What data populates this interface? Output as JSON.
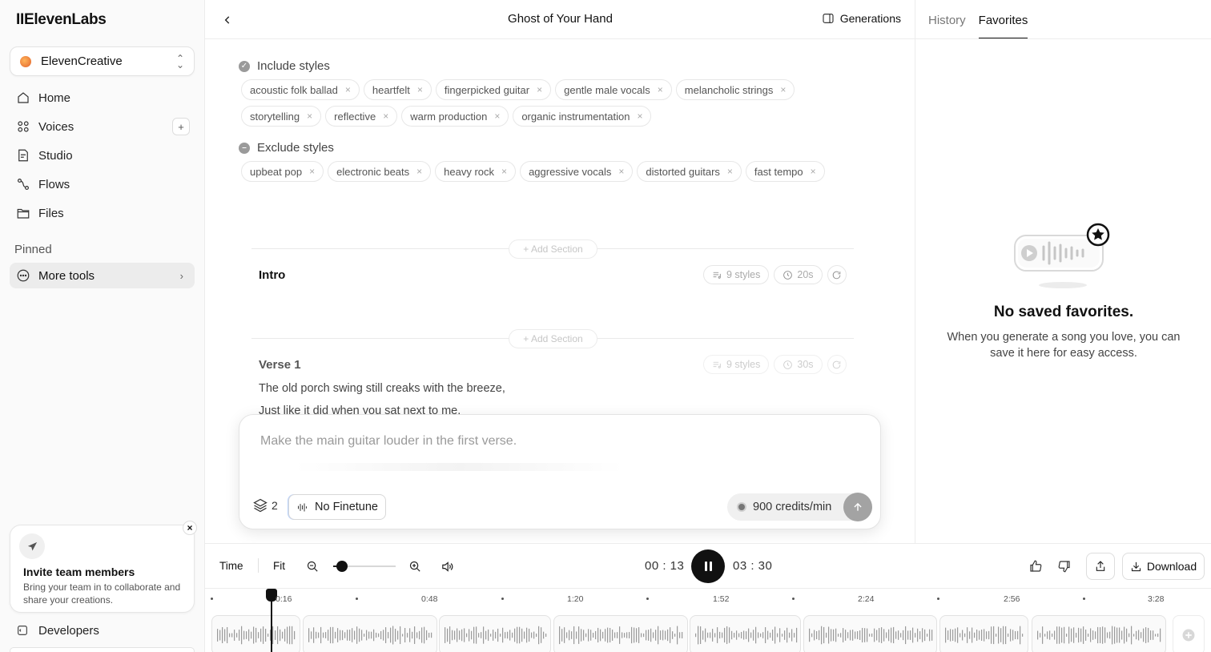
{
  "app": {
    "logo": "IIElevenLabs"
  },
  "sidebar": {
    "workspace": "ElevenCreative",
    "items": [
      {
        "label": "Home",
        "icon": "home-icon"
      },
      {
        "label": "Voices",
        "icon": "voices-icon",
        "plus": "+"
      },
      {
        "label": "Studio",
        "icon": "studio-icon"
      },
      {
        "label": "Flows",
        "icon": "flows-icon"
      },
      {
        "label": "Files",
        "icon": "files-icon"
      }
    ],
    "pinned_label": "Pinned",
    "more_tools": "More tools",
    "invite": {
      "title": "Invite team members",
      "desc": "Bring your team in to collaborate and share your creations."
    },
    "developers": "Developers"
  },
  "header": {
    "title": "Ghost of Your Hand",
    "generations": "Generations"
  },
  "right_panel": {
    "tabs": [
      "History",
      "Favorites"
    ],
    "active_tab": "Favorites",
    "empty_title": "No saved favorites.",
    "empty_desc": "When you generate a song you love, you can save it here for easy access."
  },
  "styles": {
    "include_label": "Include styles",
    "include_row1": [
      "acoustic folk ballad",
      "heartfelt",
      "fingerpicked guitar",
      "gentle male vocals",
      "melancholic strings"
    ],
    "include_row2": [
      "storytelling",
      "reflective",
      "warm production",
      "organic instrumentation"
    ],
    "exclude_label": "Exclude styles",
    "exclude": [
      "upbeat pop",
      "electronic beats",
      "heavy rock",
      "aggressive vocals",
      "distorted guitars",
      "fast tempo"
    ],
    "remove_glyph": "×"
  },
  "sections": {
    "add_label": "+ Add Section",
    "intro": {
      "title": "Intro",
      "styles": "9 styles",
      "duration": "20s"
    },
    "verse1": {
      "title": "Verse 1",
      "styles": "9 styles",
      "duration": "30s",
      "lyrics": [
        "The old porch swing still creaks with the breeze,",
        "Just like it did when you sat next to me."
      ]
    }
  },
  "prompt": {
    "placeholder": "Make the main guitar louder in the first verse.",
    "layers_count": "2",
    "finetune": "No Finetune",
    "credits": "900 credits/min"
  },
  "player": {
    "time_label": "Time",
    "fit_label": "Fit",
    "current": "00 : 13",
    "total": "03 : 30",
    "zoom_level": 0.14,
    "download": "Download"
  },
  "timeline": {
    "ticks": [
      "0:16",
      "0:48",
      "1:20",
      "1:52",
      "2:24",
      "2:56",
      "3:28"
    ],
    "playhead_time": "0:13"
  },
  "colors": {
    "accent": "#111111",
    "muted": "#9a9a9a",
    "finetune_focus": "#b9d2ff"
  }
}
